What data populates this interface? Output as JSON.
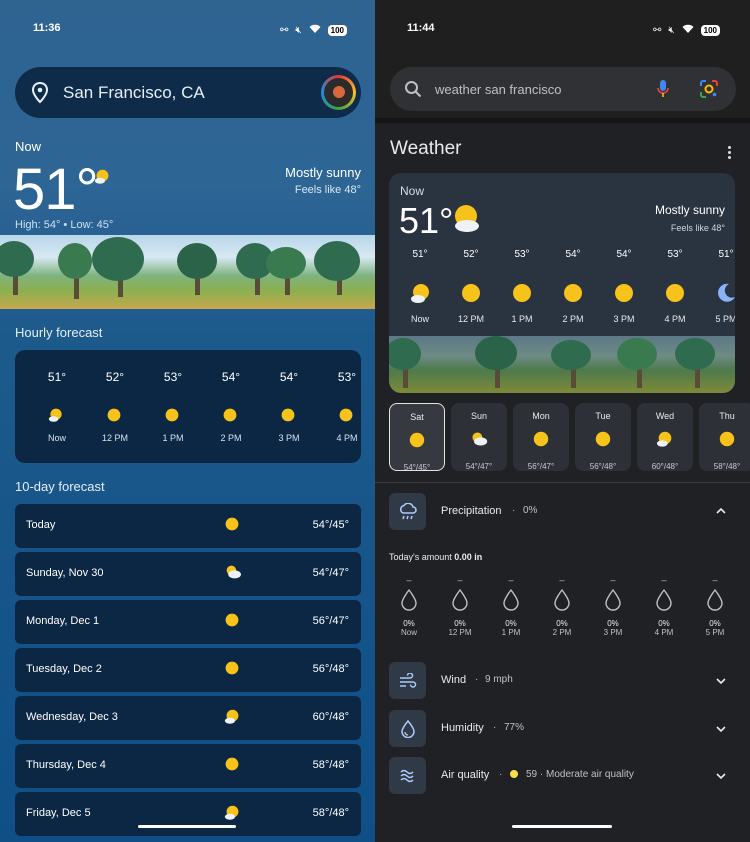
{
  "left": {
    "status_time": "11:36",
    "battery": "100",
    "location": "San Francisco, CA",
    "now_label": "Now",
    "temperature": "51°",
    "condition": "Mostly sunny",
    "feels_like": "Feels like 48°",
    "high_low": "High: 54° • Low: 45°",
    "hourly_title": "Hourly forecast",
    "hourly": [
      {
        "temp": "51°",
        "label": "Now",
        "icon": "sun-cloud-icon"
      },
      {
        "temp": "52°",
        "label": "12 PM",
        "icon": "sun-icon"
      },
      {
        "temp": "53°",
        "label": "1 PM",
        "icon": "sun-icon"
      },
      {
        "temp": "54°",
        "label": "2 PM",
        "icon": "sun-icon"
      },
      {
        "temp": "54°",
        "label": "3 PM",
        "icon": "sun-icon"
      },
      {
        "temp": "53°",
        "label": "4 PM",
        "icon": "sun-icon"
      }
    ],
    "tenday_title": "10-day forecast",
    "days": [
      {
        "name": "Today",
        "temp": "54°/45°",
        "icon": "sun-icon"
      },
      {
        "name": "Sunday, Nov 30",
        "temp": "54°/47°",
        "icon": "cloud-sun-icon"
      },
      {
        "name": "Monday, Dec 1",
        "temp": "56°/47°",
        "icon": "sun-icon"
      },
      {
        "name": "Tuesday, Dec 2",
        "temp": "56°/48°",
        "icon": "sun-icon"
      },
      {
        "name": "Wednesday, Dec 3",
        "temp": "60°/48°",
        "icon": "sun-cloud-icon"
      },
      {
        "name": "Thursday, Dec 4",
        "temp": "58°/48°",
        "icon": "sun-icon"
      },
      {
        "name": "Friday, Dec 5",
        "temp": "58°/48°",
        "icon": "sun-cloud-icon"
      }
    ]
  },
  "right": {
    "status_time": "11:44",
    "battery": "100",
    "search_query": "weather san francisco",
    "title": "Weather",
    "now_label": "Now",
    "temperature": "51°",
    "condition": "Mostly sunny",
    "feels_like": "Feels like 48°",
    "hourly": [
      {
        "temp": "51°",
        "label": "Now",
        "icon": "sun-cloud-icon"
      },
      {
        "temp": "52°",
        "label": "12 PM",
        "icon": "sun-icon"
      },
      {
        "temp": "53°",
        "label": "1 PM",
        "icon": "sun-icon"
      },
      {
        "temp": "54°",
        "label": "2 PM",
        "icon": "sun-icon"
      },
      {
        "temp": "54°",
        "label": "3 PM",
        "icon": "sun-icon"
      },
      {
        "temp": "53°",
        "label": "4 PM",
        "icon": "sun-icon"
      },
      {
        "temp": "51°",
        "label": "5 PM",
        "icon": "moon-icon"
      }
    ],
    "days": [
      {
        "name": "Sat",
        "temp": "54°/45°",
        "icon": "sun-icon",
        "selected": true
      },
      {
        "name": "Sun",
        "temp": "54°/47°",
        "icon": "cloud-sun-icon"
      },
      {
        "name": "Mon",
        "temp": "56°/47°",
        "icon": "sun-icon"
      },
      {
        "name": "Tue",
        "temp": "56°/48°",
        "icon": "sun-icon"
      },
      {
        "name": "Wed",
        "temp": "60°/48°",
        "icon": "sun-cloud-icon"
      },
      {
        "name": "Thu",
        "temp": "58°/48°",
        "icon": "sun-icon"
      }
    ],
    "precipitation": {
      "label": "Precipitation",
      "value": "0%"
    },
    "today_amount_label": "Today's amount",
    "today_amount_value": "0.00 in",
    "precip_hours": [
      {
        "dash": "–",
        "pct": "0%",
        "label": "Now"
      },
      {
        "dash": "–",
        "pct": "0%",
        "label": "12 PM"
      },
      {
        "dash": "–",
        "pct": "0%",
        "label": "1 PM"
      },
      {
        "dash": "–",
        "pct": "0%",
        "label": "2 PM"
      },
      {
        "dash": "–",
        "pct": "0%",
        "label": "3 PM"
      },
      {
        "dash": "–",
        "pct": "0%",
        "label": "4 PM"
      },
      {
        "dash": "–",
        "pct": "0%",
        "label": "5 PM"
      }
    ],
    "wind": {
      "label": "Wind",
      "value": "9 mph"
    },
    "humidity": {
      "label": "Humidity",
      "value": "77%"
    },
    "air_quality": {
      "label": "Air quality",
      "value": "59 · Moderate air quality"
    },
    "dot_sep": "·"
  },
  "colors": {
    "sun": "#f7c21a",
    "accent_blue": "#8ab4f8"
  }
}
